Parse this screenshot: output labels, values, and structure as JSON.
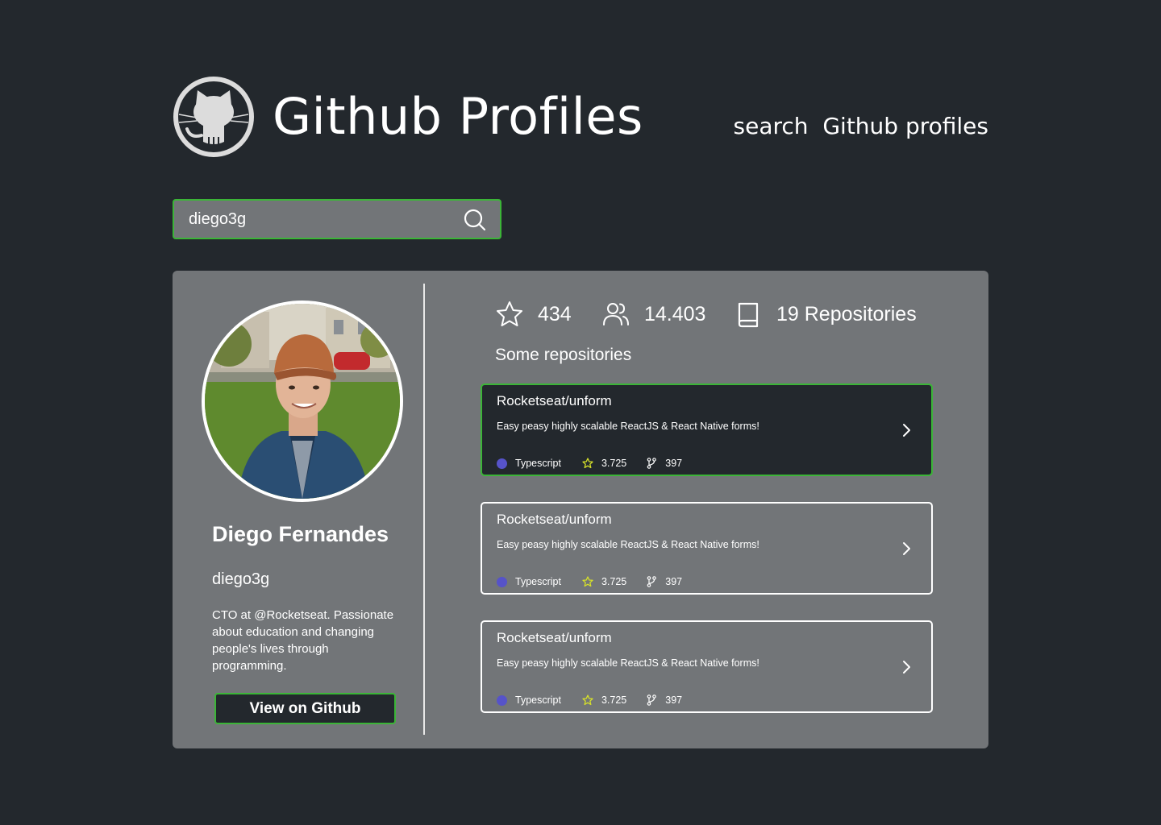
{
  "header": {
    "title": "Github Profiles",
    "tagline": "search  Github profiles",
    "logo_icon": "github-octocat-icon"
  },
  "search": {
    "value": "diego3g",
    "icon": "search-icon"
  },
  "profile": {
    "name": "Diego Fernandes",
    "login": "diego3g",
    "bio": "CTO at @Rocketseat. Passionate about education and changing people's lives through programming.",
    "view_button": "View on Github",
    "avatar_icon": "avatar-photo"
  },
  "stats": {
    "stars": "434",
    "followers": "14.403",
    "repositories": "19 Repositories"
  },
  "repos_section_title": "Some repositories",
  "repos": [
    {
      "name": "Rocketseat/unform",
      "description": "Easy peasy highly scalable ReactJS & React Native forms!",
      "language": "Typescript",
      "stars": "3.725",
      "forks": "397",
      "active": true
    },
    {
      "name": "Rocketseat/unform",
      "description": "Easy peasy highly scalable ReactJS & React Native forms!",
      "language": "Typescript",
      "stars": "3.725",
      "forks": "397",
      "active": false
    },
    {
      "name": "Rocketseat/unform",
      "description": "Easy peasy highly scalable ReactJS & React Native forms!",
      "language": "Typescript",
      "stars": "3.725",
      "forks": "397",
      "active": false
    }
  ],
  "colors": {
    "background": "#23282d",
    "card": "#727578",
    "accent": "#3bb537",
    "language_dot": "#5653c9",
    "star_icon": "#d6e02a"
  }
}
